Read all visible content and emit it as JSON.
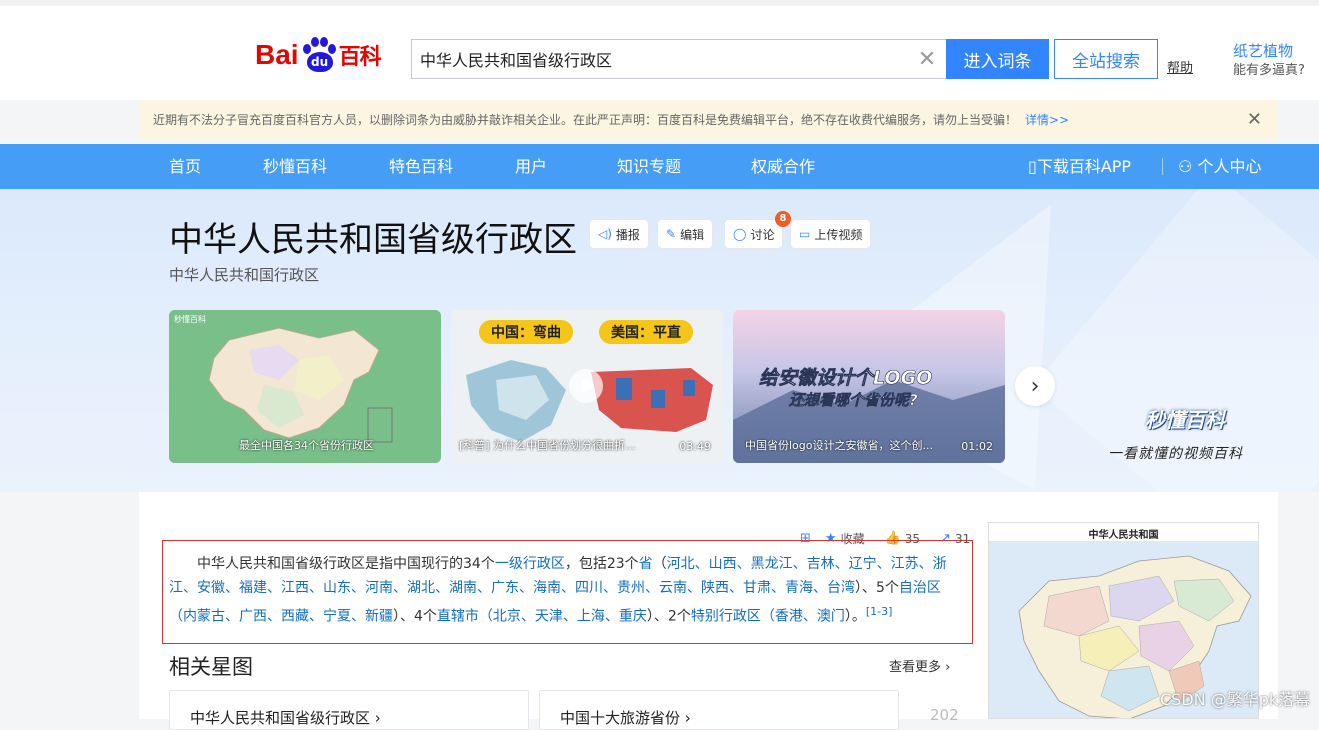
{
  "header": {
    "logo_bai": "Bai",
    "logo_du": "du",
    "logo_baike": "百科",
    "search_value": "中华人民共和国省级行政区",
    "enter_button": "进入词条",
    "site_search_button": "全站搜索",
    "help_link": "帮助",
    "side_ad_title": "纸艺植物",
    "side_ad_sub": "能有多逼真?"
  },
  "notice": {
    "text": "近期有不法分子冒充百度百科官方人员，以删除词条为由威胁并敲诈相关企业。在此严正声明：百度百科是免费编辑平台，绝不存在收费代编服务，请勿上当受骗！",
    "detail_link": "详情>>"
  },
  "nav": {
    "items": [
      "首页",
      "秒懂百科",
      "特色百科",
      "用户",
      "知识专题",
      "权威合作"
    ],
    "download_app": "下载百科APP",
    "personal_center": "个人中心"
  },
  "entry": {
    "title": "中华人民共和国省级行政区",
    "subtitle": "中华人民共和国行政区",
    "tools": [
      "播报",
      "编辑",
      "讨论",
      "上传视频"
    ],
    "discuss_badge": "8"
  },
  "videos": [
    {
      "logo": "秒懂百科",
      "caption": "最全中国各34个省份行政区",
      "duration": ""
    },
    {
      "label_left": "中国：弯曲",
      "label_right": "美国：平直",
      "caption": "[科普] 为什么中国省份划分很曲折...",
      "duration": "03:49"
    },
    {
      "headline": "给安徽设计个LOGO",
      "subline": "还想看哪个省份呢?",
      "caption": "中国省份logo设计之安徽省，这个创...",
      "duration": "01:02"
    }
  ],
  "brand": {
    "name": "秒懂百科",
    "slogan": "一看就懂的视频百科"
  },
  "stats": {
    "collect": "收藏",
    "likes": "35",
    "shares": "31"
  },
  "summary": {
    "p1": "中华人民共和国省级行政区是指中国现行的34个",
    "l1": "一级行政区",
    "p2": "，包括23个",
    "l2": "省",
    "p3": "（",
    "provinces": "河北、山西、黑龙江、吉林、辽宁、江苏、浙江、安徽、福建、江西、山东、河南、湖北、湖南、广东、海南、四川、贵州、云南、陕西、甘肃、青海、台湾",
    "p4": "）、5个",
    "l3": "自治区",
    "p5": "（",
    "regions": "内蒙古、广西、西藏、宁夏、新疆",
    "p6": "）、4个",
    "l4": "直辖市",
    "p7": "（",
    "municipalities": "北京、天津、上海、重庆",
    "p8": "）、2个",
    "l5": "特别行政区",
    "p9": "（",
    "sars": "香港、澳门",
    "p10": "）。",
    "ref": "[1-3]"
  },
  "related": {
    "title": "相关星图",
    "see_more": "查看更多",
    "cards": [
      "中华人民共和国省级行政区",
      "中国十大旅游省份"
    ],
    "third_partial": "202"
  },
  "map": {
    "title": "中华人民共和国"
  },
  "watermark": "CSDN @繁华pk落幕"
}
